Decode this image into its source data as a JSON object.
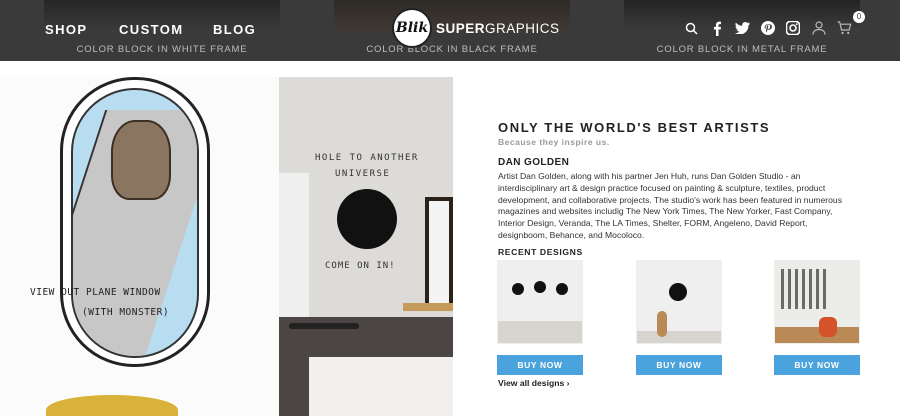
{
  "nav": {
    "shop": "SHOP",
    "custom": "CUSTOM",
    "blog": "BLOG",
    "logo_badge": "Blik",
    "logo_super": "SUPER",
    "logo_graphics": "GRAPHICS",
    "cart_count": "0"
  },
  "frame_labels": [
    "COLOR BLOCK IN WHITE FRAME",
    "COLOR BLOCK IN BLACK FRAME",
    "COLOR BLOCK IN METAL FRAME"
  ],
  "hero": {
    "caption_line1": "VIEW OUT PLANE WINDOW",
    "caption_line2": "(WITH MONSTER)",
    "wall_line1": "HOLE TO ANOTHER",
    "wall_line2": "UNIVERSE",
    "wall_line3": "COME ON IN!"
  },
  "content": {
    "headline": "ONLY THE WORLD'S BEST ARTISTS",
    "subhead": "Because they inspire us.",
    "artist": "DAN GOLDEN",
    "bio": "Artist Dan Golden, along with his partner Jen Huh, runs Dan Golden Studio - an interdisciplinary art & design practice focused on painting & sculpture, textiles, product development, and collaborative projects. The studio's work has been featured in numerous magazines and websites includig The New York Times, The New Yorker, Fast Company, Interior Design, Veranda, The LA Times, Shelter, FORM, Angeleno, David Report, designboom, Behance, and Mocoloco.",
    "recent_title": "RECENT DESIGNS",
    "buy_label": "BUY NOW",
    "view_all": "View all designs ›"
  },
  "colors": {
    "nav_bg": "#3a3a3a",
    "accent_blue": "#4aa3dd"
  },
  "icons": [
    "search-icon",
    "facebook-icon",
    "twitter-icon",
    "pinterest-icon",
    "instagram-icon",
    "user-icon",
    "cart-icon"
  ]
}
